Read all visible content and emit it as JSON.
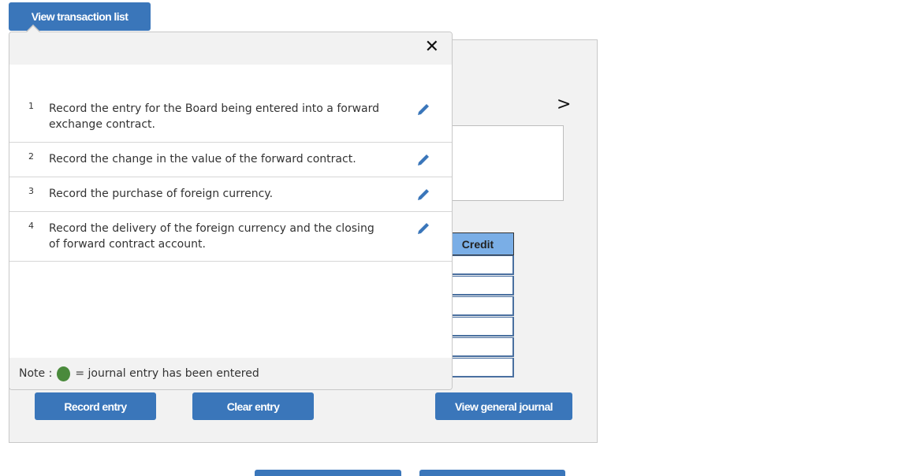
{
  "header": {
    "view_transaction_list_label": "View transaction list"
  },
  "popup": {
    "close_icon": "close-icon",
    "transactions": [
      {
        "number": "1",
        "text": "Record the entry for the Board being entered into a forward exchange contract.",
        "icon": "pencil-icon"
      },
      {
        "number": "2",
        "text": "Record the change in the value of the forward contract.",
        "icon": "pencil-icon"
      },
      {
        "number": "3",
        "text": "Record the purchase of foreign currency.",
        "icon": "pencil-icon"
      },
      {
        "number": "4",
        "text": "Record the delivery of the foreign currency and the closing of forward contract account.",
        "icon": "pencil-icon"
      }
    ],
    "note": {
      "prefix": "Note :",
      "legend": "= journal entry has been entered",
      "dot_color": "#4a8a3c"
    }
  },
  "journal": {
    "next_icon": "chevron-right-icon",
    "credit_header": "Credit",
    "credit_rows": 6
  },
  "buttons": {
    "record_entry": "Record entry",
    "clear_entry": "Clear entry",
    "view_general_journal": "View general journal"
  },
  "colors": {
    "accent": "#3a76ba",
    "header_blue": "#7aaee6",
    "panel_bg": "#f2f2f2"
  }
}
